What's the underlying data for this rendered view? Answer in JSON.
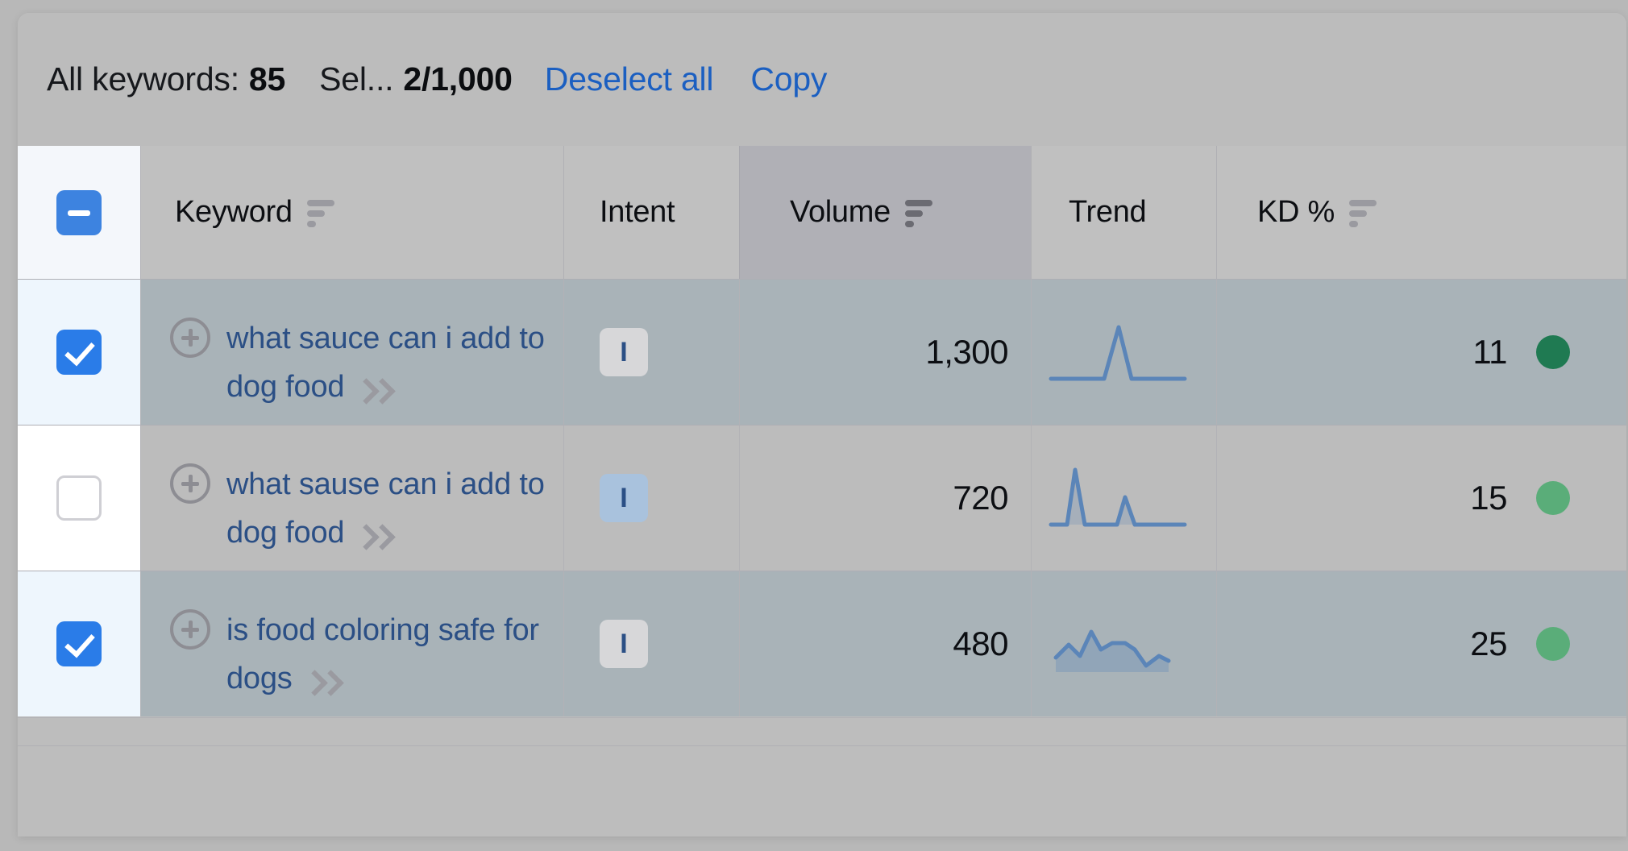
{
  "toolbar": {
    "all_keywords_label": "All keywords:",
    "all_keywords_count": "85",
    "selected_label": "Sel...",
    "selected_count": "2/1,000",
    "deselect_all_label": "Deselect all",
    "copy_label": "Copy"
  },
  "table": {
    "header": {
      "select_all_state": "indeterminate",
      "columns": [
        {
          "key": "keyword",
          "label": "Keyword",
          "sortable": true,
          "active_sort": false
        },
        {
          "key": "intent",
          "label": "Intent",
          "sortable": false,
          "active_sort": false
        },
        {
          "key": "volume",
          "label": "Volume",
          "sortable": true,
          "active_sort": true
        },
        {
          "key": "trend",
          "label": "Trend",
          "sortable": false,
          "active_sort": false
        },
        {
          "key": "kd",
          "label": "KD %",
          "sortable": true,
          "active_sort": false
        }
      ]
    },
    "rows": [
      {
        "selected": true,
        "keyword_line1": "what sauce can i add to",
        "keyword_line2": "dog food",
        "intent": "I",
        "intent_style": "plain",
        "volume": "1,300",
        "trend": "spike-late",
        "kd": "11",
        "kd_color": "#1f7a52"
      },
      {
        "selected": false,
        "keyword_line1": "what sause can i add to",
        "keyword_line2": "dog food",
        "intent": "I",
        "intent_style": "tinted",
        "volume": "720",
        "trend": "two-spikes",
        "kd": "15",
        "kd_color": "#5aad79"
      },
      {
        "selected": true,
        "keyword_line1": "is food coloring safe for",
        "keyword_line2": "dogs",
        "intent": "I",
        "intent_style": "plain",
        "volume": "480",
        "trend": "wavy",
        "kd": "25",
        "kd_color": "#5aad79"
      }
    ]
  },
  "icons": {
    "add_keyword": "plus-circle-icon",
    "expand_keyword": "double-chevron-right-icon",
    "sort": "sort-descending-icon"
  },
  "colors": {
    "link": "#1b5fc1",
    "keyword_link": "#2b4f85",
    "checkbox_checked": "#2a7ce8",
    "sparkline": "#5b85b8",
    "active_column_bg": "#b0b0b6"
  }
}
